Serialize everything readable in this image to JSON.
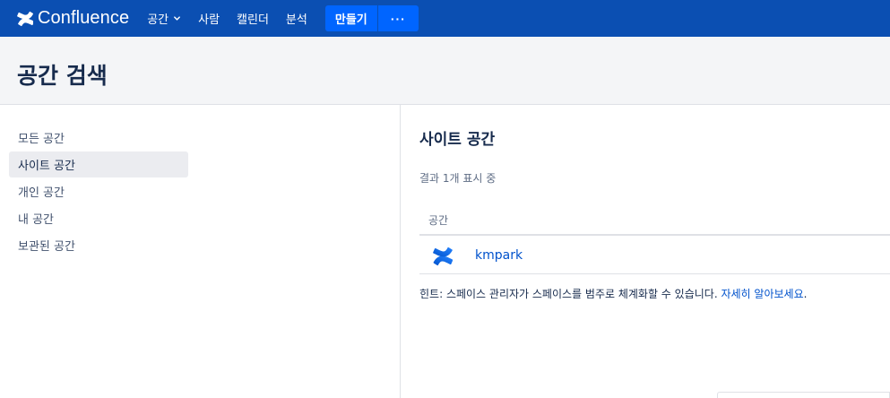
{
  "app": {
    "name": "Confluence"
  },
  "topnav": {
    "items": [
      {
        "label": "공간"
      },
      {
        "label": "사람"
      },
      {
        "label": "캘린더"
      },
      {
        "label": "분석"
      }
    ],
    "create_label": "만들기",
    "more_label": "···"
  },
  "page": {
    "title": "공간 검색"
  },
  "sidebar": {
    "items": [
      {
        "label": "모든 공간",
        "active": false
      },
      {
        "label": "사이트 공간",
        "active": true
      },
      {
        "label": "개인 공간",
        "active": false
      },
      {
        "label": "내 공간",
        "active": false
      },
      {
        "label": "보관된 공간",
        "active": false
      }
    ]
  },
  "main": {
    "section_title": "사이트 공간",
    "result_count": "결과 1개 표시 중",
    "column_header": "공간",
    "rows": [
      {
        "name": "kmpark"
      }
    ],
    "hint_text": "힌트: 스페이스 관리자가 스페이스를 범주로 체계화할 수 있습니다. ",
    "hint_link": "자세히 알아보세요",
    "hint_end": "."
  },
  "colors": {
    "nav_bg": "#0b4fb2",
    "primary_button": "#0065ff",
    "link": "#0052cc",
    "text": "#172b4d"
  }
}
